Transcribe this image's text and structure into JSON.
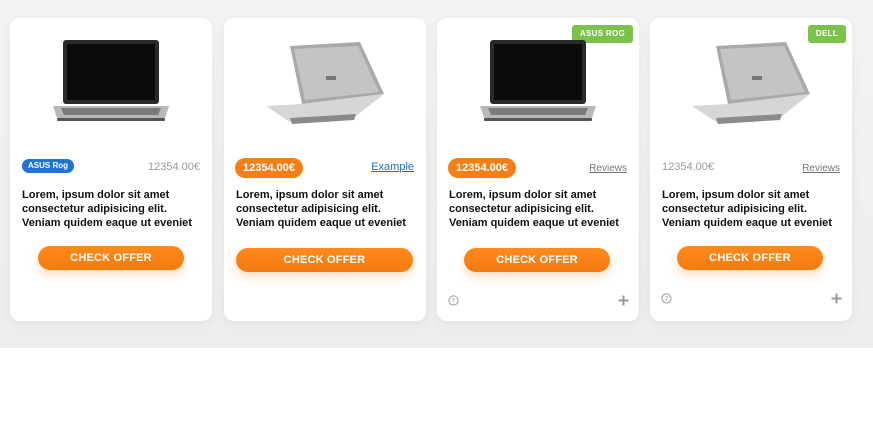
{
  "products": [
    {
      "image": "laptop-front",
      "tag": "ASUS Rog",
      "price": "12354.00€",
      "description": "Lorem, ipsum dolor sit amet consectetur adipisicing elit. Veniam quidem eaque ut eveniet",
      "cta": "CHECK OFFER"
    },
    {
      "image": "laptop-back",
      "price": "12354.00€",
      "link": "Example",
      "description": "Lorem, ipsum dolor sit amet consectetur adipisicing elit. Veniam quidem eaque ut eveniet",
      "cta": "CHECK OFFER"
    },
    {
      "image": "laptop-front",
      "badge": "ASUS ROG",
      "price": "12354.00€",
      "link": "Reviews",
      "description": "Lorem, ipsum dolor sit amet consectetur adipisicing elit. Veniam quidem eaque ut eveniet",
      "cta": "CHECK OFFER",
      "footer_icons": [
        "help-icon",
        "plus-icon"
      ]
    },
    {
      "image": "laptop-back",
      "badge": "DELL",
      "price": "12354.00€",
      "link": "Reviews",
      "description": "Lorem, ipsum dolor sit amet consectetur adipisicing elit. Veniam quidem eaque ut eveniet",
      "cta": "CHECK OFFER",
      "footer_icons": [
        "help-icon",
        "plus-icon"
      ]
    }
  ],
  "colors": {
    "accent_orange": "#f57f17",
    "tag_blue": "#1f74d4",
    "badge_green": "#7cc24a",
    "link_blue": "#1a6fbf"
  }
}
